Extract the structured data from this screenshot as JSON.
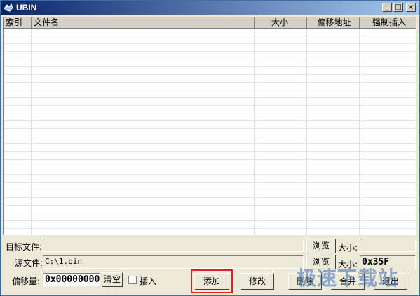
{
  "window": {
    "title": "UBIN"
  },
  "title_buttons": {
    "minimize": "_",
    "maximize": "□",
    "close": "×"
  },
  "table": {
    "columns": [
      "索引",
      "文件名",
      "大小",
      "偏移地址",
      "强制插入"
    ],
    "rows": []
  },
  "target": {
    "label": "目标文件:",
    "value": "",
    "browse": "浏览",
    "size_label": "大小:",
    "size_value": ""
  },
  "source": {
    "label": "源文件:",
    "value": "C:\\1.bin",
    "browse": "浏览",
    "size_label": "大小:",
    "size_value": "0x35F"
  },
  "offset": {
    "label": "偏移量:",
    "value": "0x00000000",
    "clear": "清空"
  },
  "insert": {
    "label": "插入",
    "checked": false
  },
  "actions": {
    "add": "添加",
    "modify": "修改",
    "delete": "删除",
    "merge": "合并",
    "exit": "退出"
  },
  "watermark": "极速下载站",
  "colors": {
    "title_start": "#0a246a",
    "title_end": "#a6caf0",
    "highlight": "#e02020"
  }
}
